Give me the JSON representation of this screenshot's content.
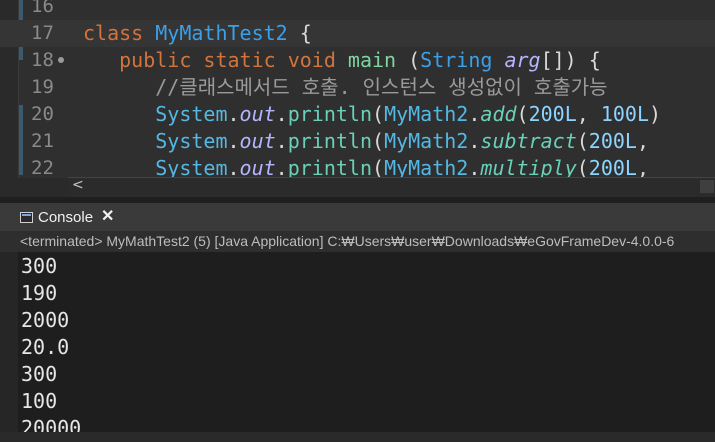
{
  "editor": {
    "line_numbers": [
      "16",
      "17",
      "18",
      "19",
      "20",
      "21",
      "22"
    ],
    "lines": [
      {
        "tokens": []
      },
      {
        "tokens": [
          {
            "t": "class ",
            "c": "kw"
          },
          {
            "t": "MyMathTest2",
            "c": "cls"
          },
          {
            "t": " {",
            "c": "pln"
          }
        ]
      },
      {
        "tokens": [
          {
            "t": "   ",
            "c": "pln"
          },
          {
            "t": "public static void ",
            "c": "kw"
          },
          {
            "t": "main",
            "c": "fn"
          },
          {
            "t": " (",
            "c": "pln"
          },
          {
            "t": "String",
            "c": "cls"
          },
          {
            "t": " ",
            "c": "pln"
          },
          {
            "t": "arg",
            "c": "fld"
          },
          {
            "t": "[]) {",
            "c": "pln"
          }
        ]
      },
      {
        "tokens": [
          {
            "t": "      //클래스메서드 호출. 인스턴스 생성없이 호출가능",
            "c": "cmt"
          }
        ]
      },
      {
        "tokens": [
          {
            "t": "      ",
            "c": "pln"
          },
          {
            "t": "System",
            "c": "sys"
          },
          {
            "t": ".",
            "c": "pln"
          },
          {
            "t": "out",
            "c": "fld"
          },
          {
            "t": ".",
            "c": "pln"
          },
          {
            "t": "println",
            "c": "mth"
          },
          {
            "t": "(",
            "c": "pln"
          },
          {
            "t": "MyMath2",
            "c": "sys"
          },
          {
            "t": ".",
            "c": "pln"
          },
          {
            "t": "add",
            "c": "mth it"
          },
          {
            "t": "(",
            "c": "pln"
          },
          {
            "t": "200L",
            "c": "num"
          },
          {
            "t": ", ",
            "c": "pln"
          },
          {
            "t": "100L",
            "c": "num"
          },
          {
            "t": ")",
            "c": "pln"
          }
        ]
      },
      {
        "tokens": [
          {
            "t": "      ",
            "c": "pln"
          },
          {
            "t": "System",
            "c": "sys"
          },
          {
            "t": ".",
            "c": "pln"
          },
          {
            "t": "out",
            "c": "fld"
          },
          {
            "t": ".",
            "c": "pln"
          },
          {
            "t": "println",
            "c": "mth"
          },
          {
            "t": "(",
            "c": "pln"
          },
          {
            "t": "MyMath2",
            "c": "sys"
          },
          {
            "t": ".",
            "c": "pln"
          },
          {
            "t": "subtract",
            "c": "mth it"
          },
          {
            "t": "(",
            "c": "pln"
          },
          {
            "t": "200L",
            "c": "num"
          },
          {
            "t": ",",
            "c": "pln"
          }
        ]
      },
      {
        "tokens": [
          {
            "t": "      ",
            "c": "pln"
          },
          {
            "t": "System",
            "c": "sys"
          },
          {
            "t": ".",
            "c": "pln"
          },
          {
            "t": "out",
            "c": "fld"
          },
          {
            "t": ".",
            "c": "pln"
          },
          {
            "t": "println",
            "c": "mth"
          },
          {
            "t": "(",
            "c": "pln"
          },
          {
            "t": "MyMath2",
            "c": "sys"
          },
          {
            "t": ".",
            "c": "pln"
          },
          {
            "t": "multiply",
            "c": "mth it"
          },
          {
            "t": "(",
            "c": "pln"
          },
          {
            "t": "200L",
            "c": "num"
          },
          {
            "t": ",",
            "c": "pln"
          }
        ]
      }
    ],
    "fold_marker_line": "18",
    "scroll_left_glyph": "<"
  },
  "console": {
    "tab_label": "Console",
    "close_glyph": "✕",
    "status": "<terminated> MyMathTest2 (5) [Java Application] C:₩Users₩user₩Downloads₩eGovFrameDev-4.0.0-6",
    "output": [
      "300",
      "190",
      "2000",
      "20.0",
      "300",
      "100",
      "20000"
    ]
  },
  "colors": {
    "keyword": "#d2743c",
    "class": "#3aa0e8",
    "comment": "#9a9a9a",
    "number": "#8dd4ff"
  }
}
